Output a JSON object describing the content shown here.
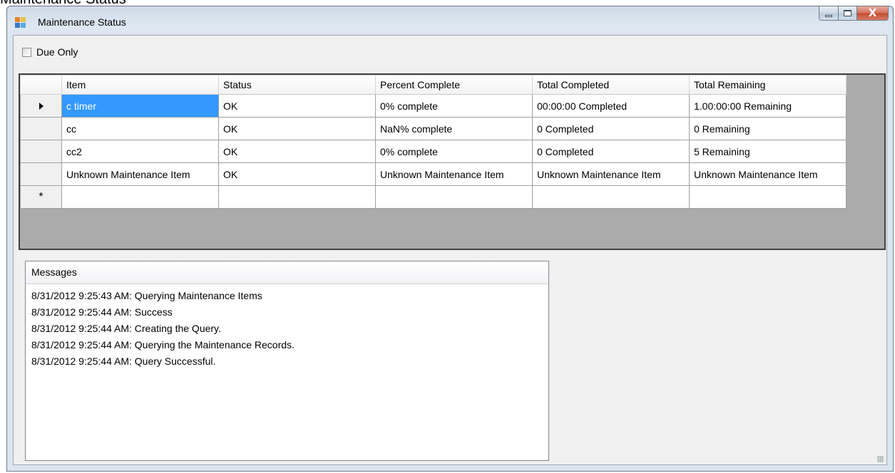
{
  "page": {
    "caption": "Maintenance Status"
  },
  "window": {
    "title": "Maintenance Status",
    "buttons": {
      "close_glyph": "X"
    }
  },
  "filter": {
    "due_only_label": "Due Only",
    "due_only_checked": false
  },
  "grid": {
    "columns": [
      "Item",
      "Status",
      "Percent Complete",
      "Total Completed",
      "Total Remaining"
    ],
    "rows": [
      [
        "c timer",
        "OK",
        "0% complete",
        "00:00:00 Completed",
        "1.00:00:00 Remaining"
      ],
      [
        "cc",
        "OK",
        "NaN% complete",
        "0 Completed",
        "0 Remaining"
      ],
      [
        "cc2",
        "OK",
        "0% complete",
        "0 Completed",
        "5 Remaining"
      ],
      [
        "Unknown Maintenance Item",
        "OK",
        "Unknown Maintenance Item",
        "Unknown Maintenance Item",
        "Unknown Maintenance Item"
      ]
    ],
    "current_row_marker": "▶",
    "new_row_marker": "*"
  },
  "messages": {
    "header": "Messages",
    "items": [
      "8/31/2012 9:25:43 AM: Querying Maintenance Items",
      "8/31/2012 9:25:44 AM: Success",
      "8/31/2012 9:25:44 AM: Creating the Query.",
      "8/31/2012 9:25:44 AM: Querying the Maintenance Records.",
      "8/31/2012 9:25:44 AM: Query Successful."
    ]
  },
  "colors": {
    "selection": "#3399ff",
    "grid_background": "#ababab",
    "close_button": "#c44a30"
  },
  "icons": [
    "app-icon",
    "minimize-icon",
    "maximize-icon",
    "close-icon",
    "row-selector-arrow-icon",
    "new-row-star-icon",
    "resize-grip-icon"
  ]
}
